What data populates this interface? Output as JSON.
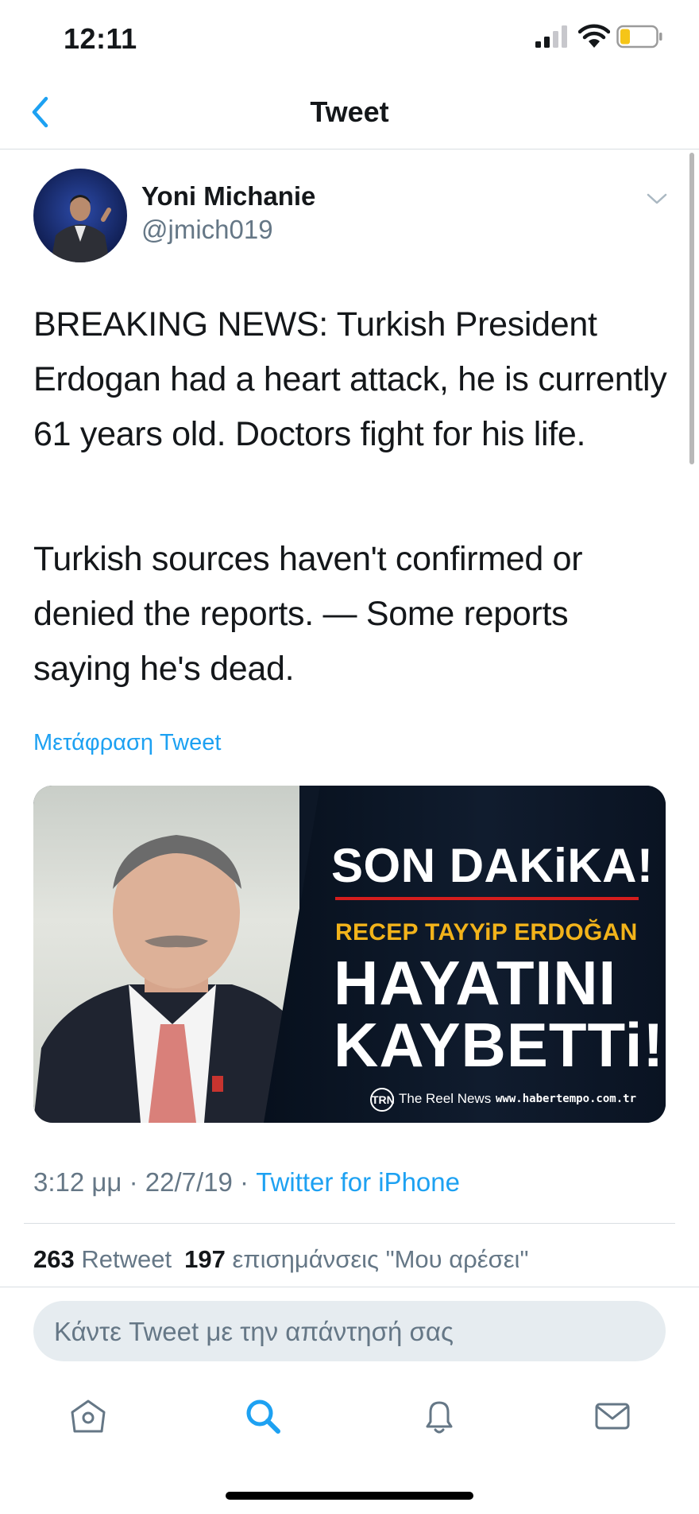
{
  "status_bar": {
    "time": "12:11"
  },
  "nav": {
    "title": "Tweet"
  },
  "author": {
    "name": "Yoni Michanie",
    "handle": "@jmich019"
  },
  "tweet": {
    "paragraph1": "BREAKING NEWS: Turkish President Erdogan had a heart attack, he is currently 61 years old. Doctors fight for his life.",
    "paragraph2": "Turkish sources haven't confirmed or denied the reports. — Some reports saying he's dead.",
    "translate_label": "Μετάφραση Tweet"
  },
  "media": {
    "headline": "SON DAKiKA!",
    "subheadline": "RECEP TAYYiP ERDOĞAN",
    "big_line1": "HAYATINI",
    "big_line2": "KAYBETTi!",
    "logo_mark": "TRN",
    "brand": "The Reel News",
    "url": "www.habertempo.com.tr"
  },
  "meta": {
    "time": "3:12 μμ",
    "date": "22/7/19",
    "separator": " · ",
    "source": "Twitter for iPhone"
  },
  "stats": {
    "retweets_count": "263",
    "retweets_label": "Retweet",
    "likes_count": "197",
    "likes_label": "επισημάνσεις \"Μου αρέσει\""
  },
  "reply": {
    "placeholder": "Κάντε Tweet με την απάντησή σας"
  },
  "tabs": [
    "home-icon",
    "search-icon",
    "bell-icon",
    "mail-icon"
  ],
  "colors": {
    "accent": "#1da1f2",
    "secondary_text": "#657786",
    "reply_bg": "#e6ecf0",
    "battery_level": "#f5c518"
  }
}
